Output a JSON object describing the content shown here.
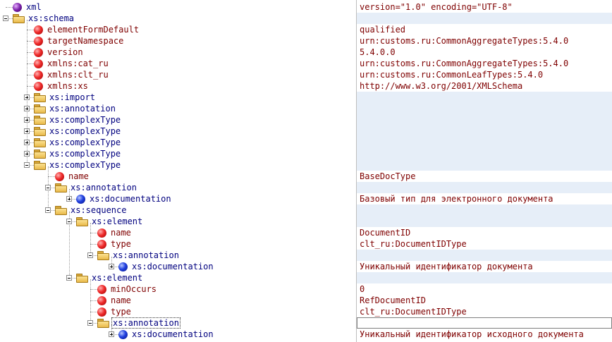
{
  "nodes": [
    {
      "label": "xml",
      "kind": "xml",
      "toggle": "none",
      "depth": 0,
      "value": "version=\"1.0\" encoding=\"UTF-8\""
    },
    {
      "label": "xs:schema",
      "kind": "folder",
      "toggle": "expanded",
      "depth": 0,
      "value": ""
    },
    {
      "label": "elementFormDefault",
      "kind": "attr",
      "toggle": "none",
      "depth": 1,
      "value": "qualified"
    },
    {
      "label": "targetNamespace",
      "kind": "attr",
      "toggle": "none",
      "depth": 1,
      "value": "urn:customs.ru:CommonAggregateTypes:5.4.0"
    },
    {
      "label": "version",
      "kind": "attr",
      "toggle": "none",
      "depth": 1,
      "value": "5.4.0.0"
    },
    {
      "label": "xmlns:cat_ru",
      "kind": "attr",
      "toggle": "none",
      "depth": 1,
      "value": "urn:customs.ru:CommonAggregateTypes:5.4.0"
    },
    {
      "label": "xmlns:clt_ru",
      "kind": "attr",
      "toggle": "none",
      "depth": 1,
      "value": "urn:customs.ru:CommonLeafTypes:5.4.0"
    },
    {
      "label": "xmlns:xs",
      "kind": "attr",
      "toggle": "none",
      "depth": 1,
      "value": "http://www.w3.org/2001/XMLSchema"
    },
    {
      "label": "xs:import",
      "kind": "folder",
      "toggle": "collapsed",
      "depth": 1,
      "value": ""
    },
    {
      "label": "xs:annotation",
      "kind": "folder",
      "toggle": "collapsed",
      "depth": 1,
      "value": ""
    },
    {
      "label": "xs:complexType",
      "kind": "folder",
      "toggle": "collapsed",
      "depth": 1,
      "value": ""
    },
    {
      "label": "xs:complexType",
      "kind": "folder",
      "toggle": "collapsed",
      "depth": 1,
      "value": ""
    },
    {
      "label": "xs:complexType",
      "kind": "folder",
      "toggle": "collapsed",
      "depth": 1,
      "value": ""
    },
    {
      "label": "xs:complexType",
      "kind": "folder",
      "toggle": "collapsed",
      "depth": 1,
      "value": ""
    },
    {
      "label": "xs:complexType",
      "kind": "folder",
      "toggle": "expanded",
      "depth": 1,
      "value": ""
    },
    {
      "label": "name",
      "kind": "attr",
      "toggle": "none",
      "depth": 2,
      "value": "BaseDocType"
    },
    {
      "label": "xs:annotation",
      "kind": "folder",
      "toggle": "expanded",
      "depth": 2,
      "value": ""
    },
    {
      "label": "xs:documentation",
      "kind": "doc",
      "toggle": "collapsed",
      "depth": 3,
      "value": "Базовый тип для электронного документа"
    },
    {
      "label": "xs:sequence",
      "kind": "folder",
      "toggle": "expanded",
      "depth": 2,
      "value": ""
    },
    {
      "label": "xs:element",
      "kind": "folder",
      "toggle": "expanded",
      "depth": 3,
      "value": ""
    },
    {
      "label": "name",
      "kind": "attr",
      "toggle": "none",
      "depth": 4,
      "value": "DocumentID"
    },
    {
      "label": "type",
      "kind": "attr",
      "toggle": "none",
      "depth": 4,
      "value": "clt_ru:DocumentIDType"
    },
    {
      "label": "xs:annotation",
      "kind": "folder",
      "toggle": "expanded",
      "depth": 4,
      "value": ""
    },
    {
      "label": "xs:documentation",
      "kind": "doc",
      "toggle": "collapsed",
      "depth": 5,
      "value": "Уникальный идентификатор документа"
    },
    {
      "label": "xs:element",
      "kind": "folder",
      "toggle": "expanded",
      "depth": 3,
      "value": ""
    },
    {
      "label": "minOccurs",
      "kind": "attr",
      "toggle": "none",
      "depth": 4,
      "value": "0"
    },
    {
      "label": "name",
      "kind": "attr",
      "toggle": "none",
      "depth": 4,
      "value": "RefDocumentID"
    },
    {
      "label": "type",
      "kind": "attr",
      "toggle": "none",
      "depth": 4,
      "value": "clt_ru:DocumentIDType"
    },
    {
      "label": "xs:annotation",
      "kind": "folder",
      "toggle": "expanded",
      "depth": 4,
      "value": "",
      "selected": true
    },
    {
      "label": "xs:documentation",
      "kind": "doc",
      "toggle": "collapsed",
      "depth": 5,
      "value": "Уникальный идентификатор исходного документа"
    }
  ]
}
